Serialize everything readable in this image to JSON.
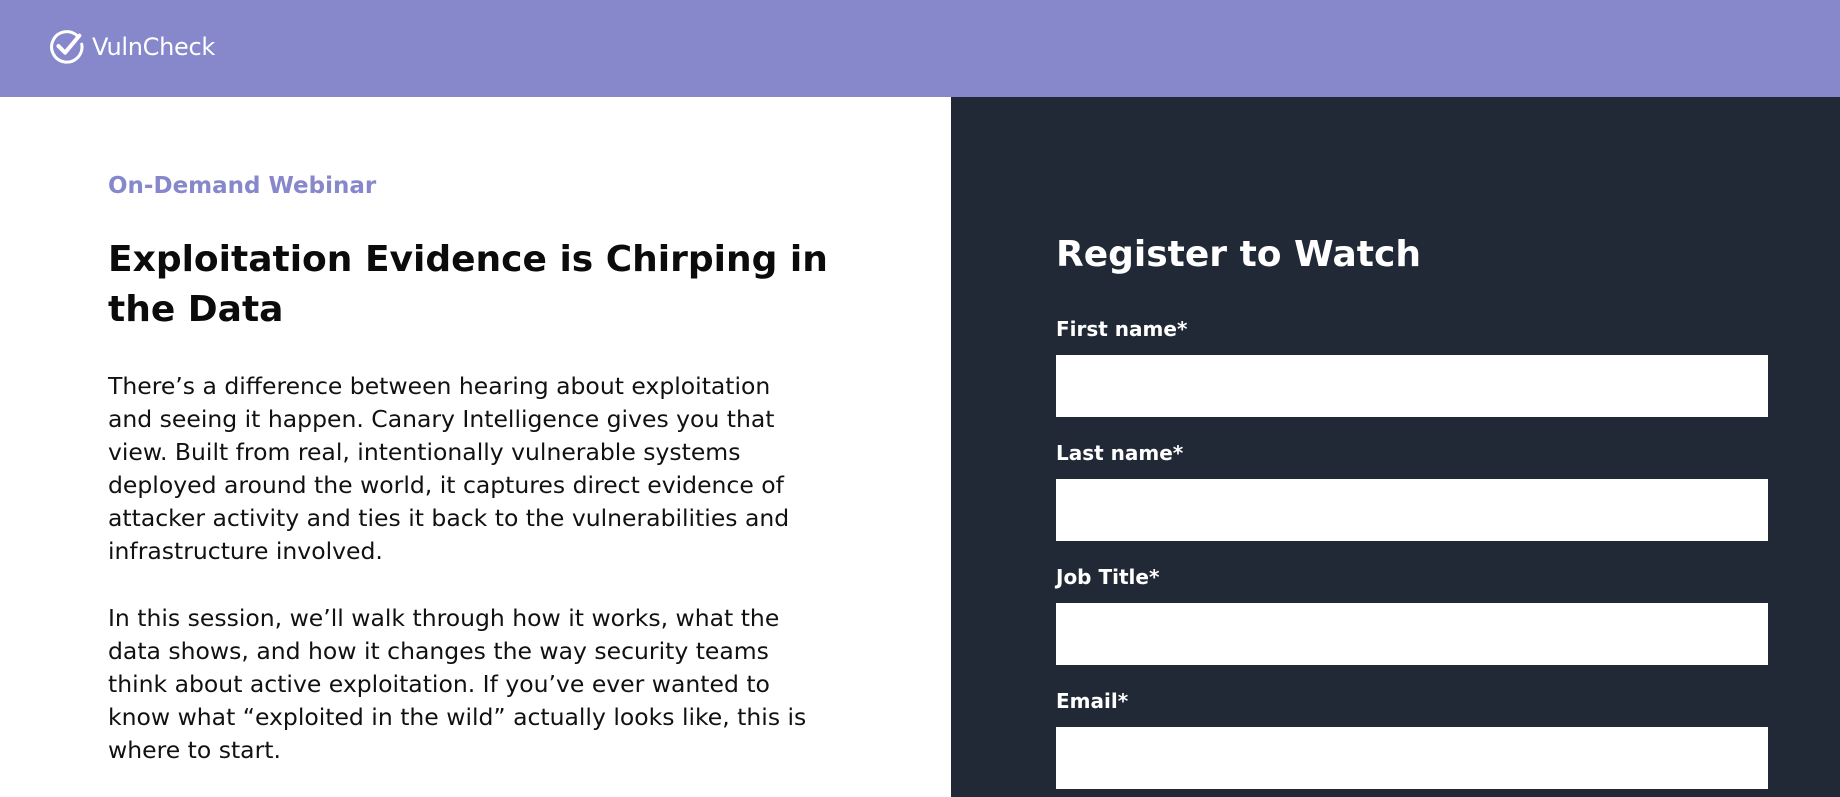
{
  "header": {
    "brand_name": "VulnCheck",
    "logo_icon": "check-circle-icon",
    "background_color": "#8787cc"
  },
  "content": {
    "eyebrow": "On-Demand Webinar",
    "title": "Exploitation Evidence is Chirping in the Data",
    "paragraph_1": "There’s a difference between hearing about exploitation and seeing it happen. Canary Intelligence gives you that view. Built from real, intentionally vulnerable systems deployed around the world, it captures direct evidence of attacker activity and ties it back to the vulnerabilities and infrastructure involved.",
    "paragraph_2": "In this session, we’ll walk through how it works, what the data shows, and how it changes the way security teams think about active exploitation. If you’ve ever wanted to know what “exploited in the wild” actually looks like, this is where to start."
  },
  "form": {
    "title": "Register to Watch",
    "background_color": "#212936",
    "fields": [
      {
        "label": "First name*",
        "value": ""
      },
      {
        "label": "Last name*",
        "value": ""
      },
      {
        "label": "Job Title*",
        "value": ""
      },
      {
        "label": "Email*",
        "value": ""
      }
    ]
  }
}
